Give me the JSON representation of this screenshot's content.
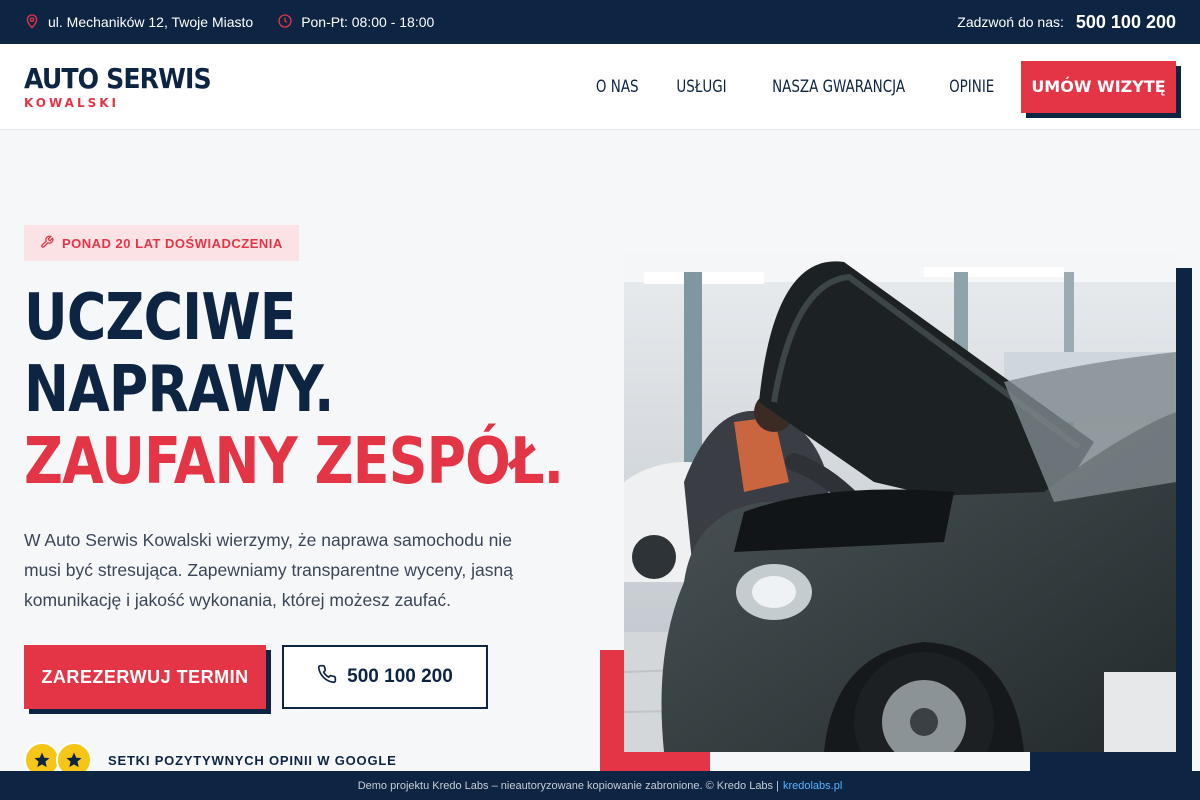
{
  "topbar": {
    "address": "ul. Mechaników 12, Twoje Miasto",
    "hours": "Pon-Pt: 08:00 - 18:00",
    "call_label": "Zadzwoń do nas:",
    "phone": "500 100 200",
    "icons": [
      "pin-icon",
      "clock-icon",
      "phone-icon"
    ],
    "colors": {
      "bg": "#0d2542",
      "accent": "#e33546"
    }
  },
  "header": {
    "logo_main": "AUTO SERWIS",
    "logo_sub": "KOWALSKI",
    "nav": [
      "O NAS",
      "USŁUGI",
      "NASZA GWARANCJA",
      "OPINIE"
    ],
    "cta": "UMÓW WIZYTĘ"
  },
  "hero": {
    "badge": "PONAD 20 LAT DOŚWIADCZENIA",
    "title_line1": "UCZCIWE",
    "title_line2": "NAPRAWY.",
    "title_line3": "ZAUFANY ZESPÓŁ.",
    "lead": "W Auto Serwis Kowalski wierzymy, że naprawa samochodu nie musi być stresująca. Zapewniamy transparentne wyceny, jasną komunikację i jakość wykonania, której możesz zaufać.",
    "primary_button": "ZAREZERWUJ TERMIN",
    "secondary_button": "500 100 200",
    "rating_label": "SETKI POZYTYWNYCH OPINII W GOOGLE",
    "colors": {
      "navy": "#0d2542",
      "red": "#e33546",
      "badge_bg": "#fbe2e4",
      "star": "#f5c518"
    }
  },
  "footer": {
    "text": "Demo projektu Kredo Labs – nieautoryzowane kopiowanie zabronione. © Kredo Labs |",
    "link": "kredolabs.pl"
  }
}
